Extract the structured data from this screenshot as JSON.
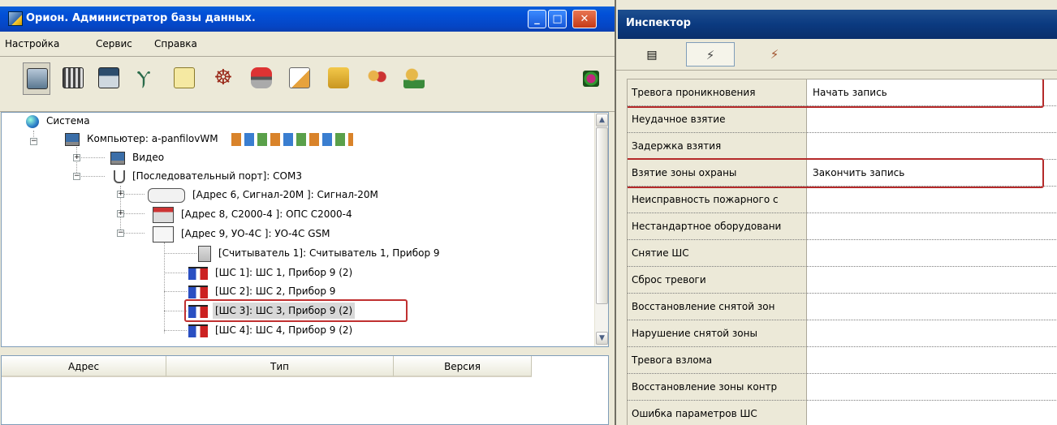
{
  "left_window": {
    "title": "Орион. Администратор базы данных.",
    "caption_buttons": {
      "minimize": "_",
      "maximize": "□",
      "close": "✕"
    },
    "menu": [
      "Настройка",
      "Сервис",
      "Справка"
    ],
    "toolbar_icons": [
      "computers-icon",
      "devices-icon",
      "monitor-panel-icon",
      "palm-tree-icon",
      "notepad-icon",
      "wheel-icon",
      "train-icon",
      "schedule-icon",
      "folder-people-icon",
      "users-icon",
      "user-key-icon",
      "bug-icon"
    ],
    "tree": {
      "root": "Система",
      "computer": "Компьютер: a-panfilovWM",
      "video": "Видео",
      "port": "[Последовательный порт]: COM3",
      "dev1": "[Адрес 6, Сигнал-20М ]: Сигнал-20М",
      "dev2": "[Адрес 8, С2000-4 ]: ОПС С2000-4",
      "dev3": "[Адрес 9, УО-4С ]: УО-4С  GSM",
      "reader": "[Считыватель 1]: Считыватель 1, Прибор 9",
      "sh1": "[ШС 1]: ШС 1, Прибор 9 (2)",
      "sh2": "[ШС 2]: ШС 2, Прибор 9",
      "sh3": "[ШС 3]: ШС 3, Прибор 9 (2)",
      "sh4": "[ШС 4]: ШС 4, Прибор 9 (2)"
    },
    "list_columns": [
      "Адрес",
      "Тип",
      "Версия"
    ]
  },
  "inspector": {
    "title": "Инспектор",
    "tabs": [
      "list-icon",
      "lightning-icon",
      "user-lightning-icon"
    ],
    "rows": [
      {
        "name": "Тревога проникновения",
        "value": "Начать запись"
      },
      {
        "name": "Неудачное взятие",
        "value": ""
      },
      {
        "name": "Задержка взятия",
        "value": ""
      },
      {
        "name": "Взятие зоны охраны",
        "value": "Закончить запись"
      },
      {
        "name": "Неисправность пожарного с",
        "value": ""
      },
      {
        "name": "Нестандартное оборудовани",
        "value": ""
      },
      {
        "name": "Снятие ШС",
        "value": ""
      },
      {
        "name": "Сброс тревоги",
        "value": ""
      },
      {
        "name": "Восстановление снятой зон",
        "value": ""
      },
      {
        "name": "Нарушение снятой зоны",
        "value": ""
      },
      {
        "name": "Тревога взлома",
        "value": ""
      },
      {
        "name": "Восстановление зоны контр",
        "value": ""
      },
      {
        "name": "Ошибка параметров ШС",
        "value": ""
      }
    ]
  }
}
